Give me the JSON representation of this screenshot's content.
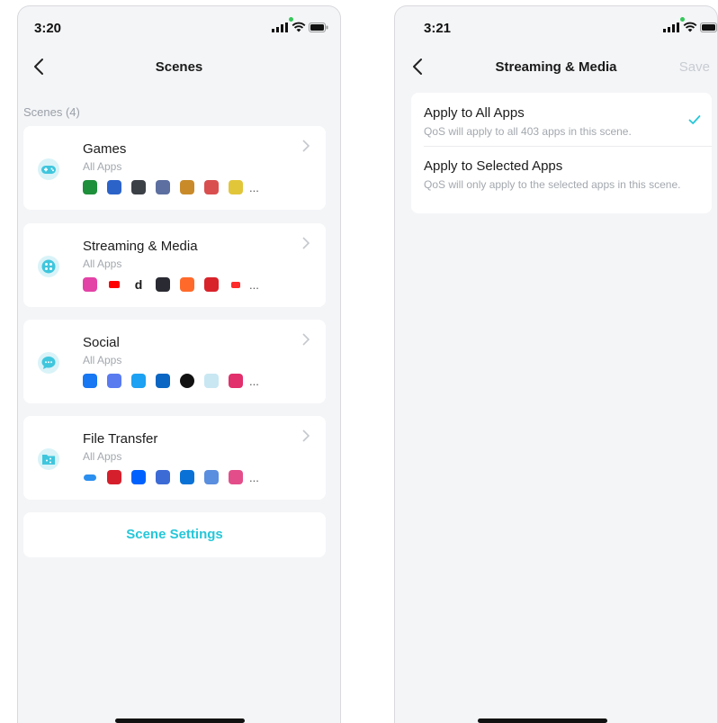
{
  "left_screen": {
    "status": {
      "time": "3:20"
    },
    "nav": {
      "title": "Scenes"
    },
    "section_label": "Scenes (4)",
    "scenes": [
      {
        "title": "Games",
        "subtitle": "All Apps",
        "icon": "gamepad-icon",
        "apps": [
          "xbox-icon",
          "wordfeud-icon",
          "game-app-icon",
          "game-app-icon",
          "game-app-icon",
          "game-app-icon",
          "game-app-icon"
        ],
        "app_colors": [
          "#1e8f3a",
          "#2c63c9",
          "#3b3f46",
          "#5d6fa0",
          "#c98b2a",
          "#d94f4f",
          "#e2c63a"
        ]
      },
      {
        "title": "Streaming & Media",
        "subtitle": "All Apps",
        "icon": "film-reel-icon",
        "apps": [
          "itunes-icon",
          "youtube-icon",
          "dailymotion-icon",
          "media-app-icon",
          "soundcloud-icon",
          "media-app-icon",
          "youtube-icon"
        ],
        "app_colors": [
          "#e342a6",
          "#ff0000",
          "#1a1a1a",
          "#2a2a33",
          "#ff6a2a",
          "#d8232a",
          "#ff2a2a"
        ]
      },
      {
        "title": "Social",
        "subtitle": "All Apps",
        "icon": "chat-bubble-icon",
        "apps": [
          "facebook-icon",
          "social-app-icon",
          "twitter-icon",
          "linkedin-icon",
          "messages-icon",
          "social-app-icon",
          "instagram-icon"
        ],
        "app_colors": [
          "#1877f2",
          "#5a7bf0",
          "#1da1f2",
          "#0a66c2",
          "#111111",
          "#c9e7f2",
          "#e1306c"
        ]
      },
      {
        "title": "File Transfer",
        "subtitle": "All Apps",
        "icon": "share-folder-icon",
        "apps": [
          "cloud-icon",
          "unlimited-icon",
          "dropbox-icon",
          "share-app-icon",
          "box-icon",
          "transfer-app-icon",
          "creative-cloud-icon"
        ],
        "app_colors": [
          "#2b8ff0",
          "#d61f2c",
          "#0061fe",
          "#3d6bd6",
          "#0a72d6",
          "#5a8ede",
          "#e34e8a"
        ]
      }
    ],
    "more_symbol": "...",
    "scene_settings_label": "Scene Settings"
  },
  "right_screen": {
    "status": {
      "time": "3:21"
    },
    "nav": {
      "title": "Streaming & Media",
      "save_label": "Save"
    },
    "options": [
      {
        "title": "Apply to All Apps",
        "description": "QoS will apply to all 403 apps in this scene.",
        "selected": true
      },
      {
        "title": "Apply to Selected Apps",
        "description": "QoS will only apply to the selected apps in this scene.",
        "selected": false
      }
    ]
  },
  "colors": {
    "accent": "#25c7d9",
    "background": "#f4f5f7",
    "card": "#ffffff",
    "muted_text": "#a3a8ae"
  }
}
